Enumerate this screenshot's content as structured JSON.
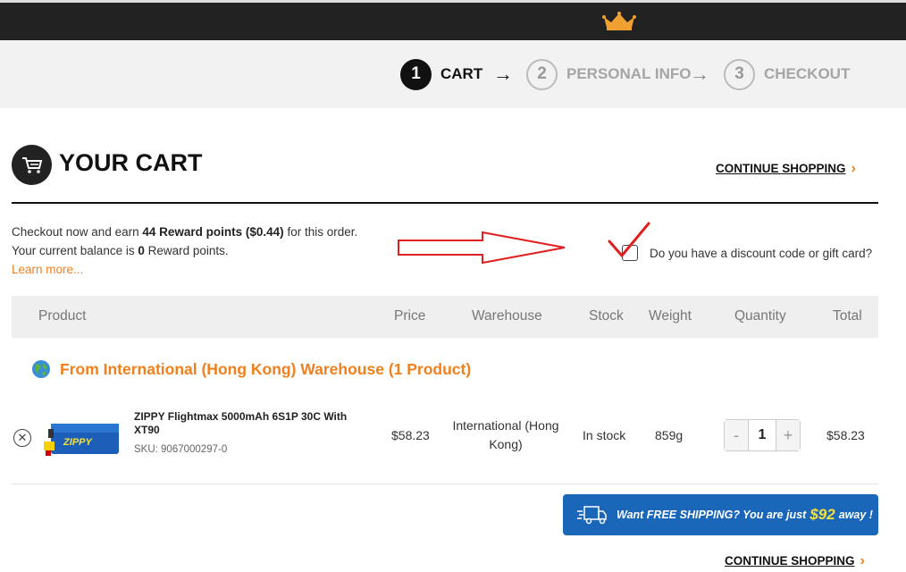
{
  "steps": [
    {
      "num": "1",
      "label": "CART"
    },
    {
      "num": "2",
      "label": "PERSONAL INFO"
    },
    {
      "num": "3",
      "label": "CHECKOUT"
    }
  ],
  "cart": {
    "title": "YOUR CART",
    "continue_label": "CONTINUE SHOPPING"
  },
  "reward": {
    "line1_pre": "Checkout now and earn ",
    "points": "44 Reward points",
    "value": "($0.44)",
    "line1_post": " for this order.",
    "line2_pre": "Your current balance is ",
    "balance": "0",
    "line2_post": " Reward points.",
    "learn_more": "Learn more..."
  },
  "discount": {
    "label": "Do you have a discount code or gift card?"
  },
  "table": {
    "headers": [
      "Product",
      "Price",
      "Warehouse",
      "Stock",
      "Weight",
      "Quantity",
      "Total"
    ]
  },
  "warehouse_group": {
    "title": "From International (Hong Kong) Warehouse (1 Product)"
  },
  "items": [
    {
      "name": "ZIPPY Flightmax 5000mAh 6S1P 30C With XT90",
      "sku": "SKU: 9067000297-0",
      "price": "$58.23",
      "warehouse": "International (Hong Kong)",
      "stock": "In stock",
      "weight": "859g",
      "quantity": "1",
      "total": "$58.23"
    }
  ],
  "shipping_banner": {
    "pre": "Want FREE SHIPPING? You are just",
    "amount": "$92",
    "post": "away !"
  },
  "colors": {
    "accent": "#f0801d",
    "banner": "#1a66b9",
    "topbar": "#222222",
    "annotation": "#e02020"
  }
}
